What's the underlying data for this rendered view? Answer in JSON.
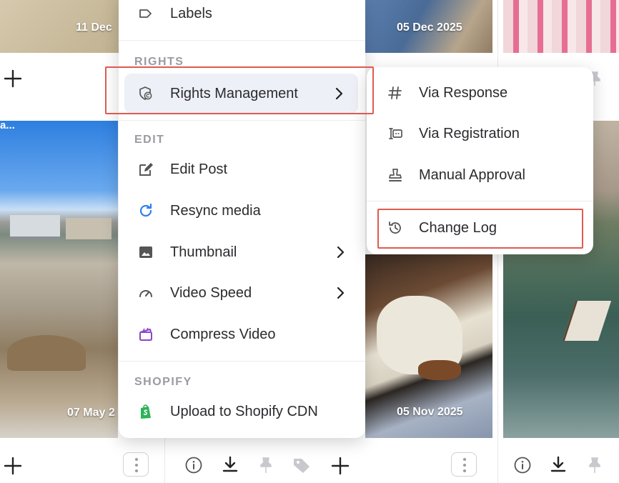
{
  "grid": {
    "dates": {
      "top_left": "11 Dec",
      "top_mid": "05 Dec 2025",
      "bottom_left": "07 May 2",
      "bottom_mid": "05 Nov 2025"
    },
    "overlay_text": "a..."
  },
  "menu": {
    "top_item": {
      "label": "Labels",
      "icon": "tag-outline-icon"
    },
    "sections": {
      "rights": "RIGHTS",
      "edit": "EDIT",
      "shopify": "SHOPIFY"
    },
    "rights_management": {
      "label": "Rights Management",
      "icon": "shield-copyright-icon",
      "active": true
    },
    "edit_items": [
      {
        "label": "Edit Post",
        "icon": "edit-icon"
      },
      {
        "label": "Resync media",
        "icon": "refresh-icon"
      },
      {
        "label": "Thumbnail",
        "icon": "image-icon"
      },
      {
        "label": "Video Speed",
        "icon": "speedometer-icon"
      },
      {
        "label": "Compress Video",
        "icon": "clapperboard-icon"
      }
    ],
    "shopify_item": {
      "label": "Upload to Shopify CDN",
      "icon": "shopify-bag-icon"
    }
  },
  "submenu": {
    "items": [
      {
        "label": "Via Response",
        "icon": "hash-icon"
      },
      {
        "label": "Via Registration",
        "icon": "registration-form-icon"
      },
      {
        "label": "Manual Approval",
        "icon": "stamp-icon"
      },
      {
        "label": "Change Log",
        "icon": "history-icon"
      }
    ]
  },
  "colors": {
    "highlight_red": "#e05a50",
    "active_bg": "#edf0f6",
    "resync_blue": "#2f80ed",
    "compress_purple": "#8e44c9",
    "shopify_green": "#2db357"
  }
}
